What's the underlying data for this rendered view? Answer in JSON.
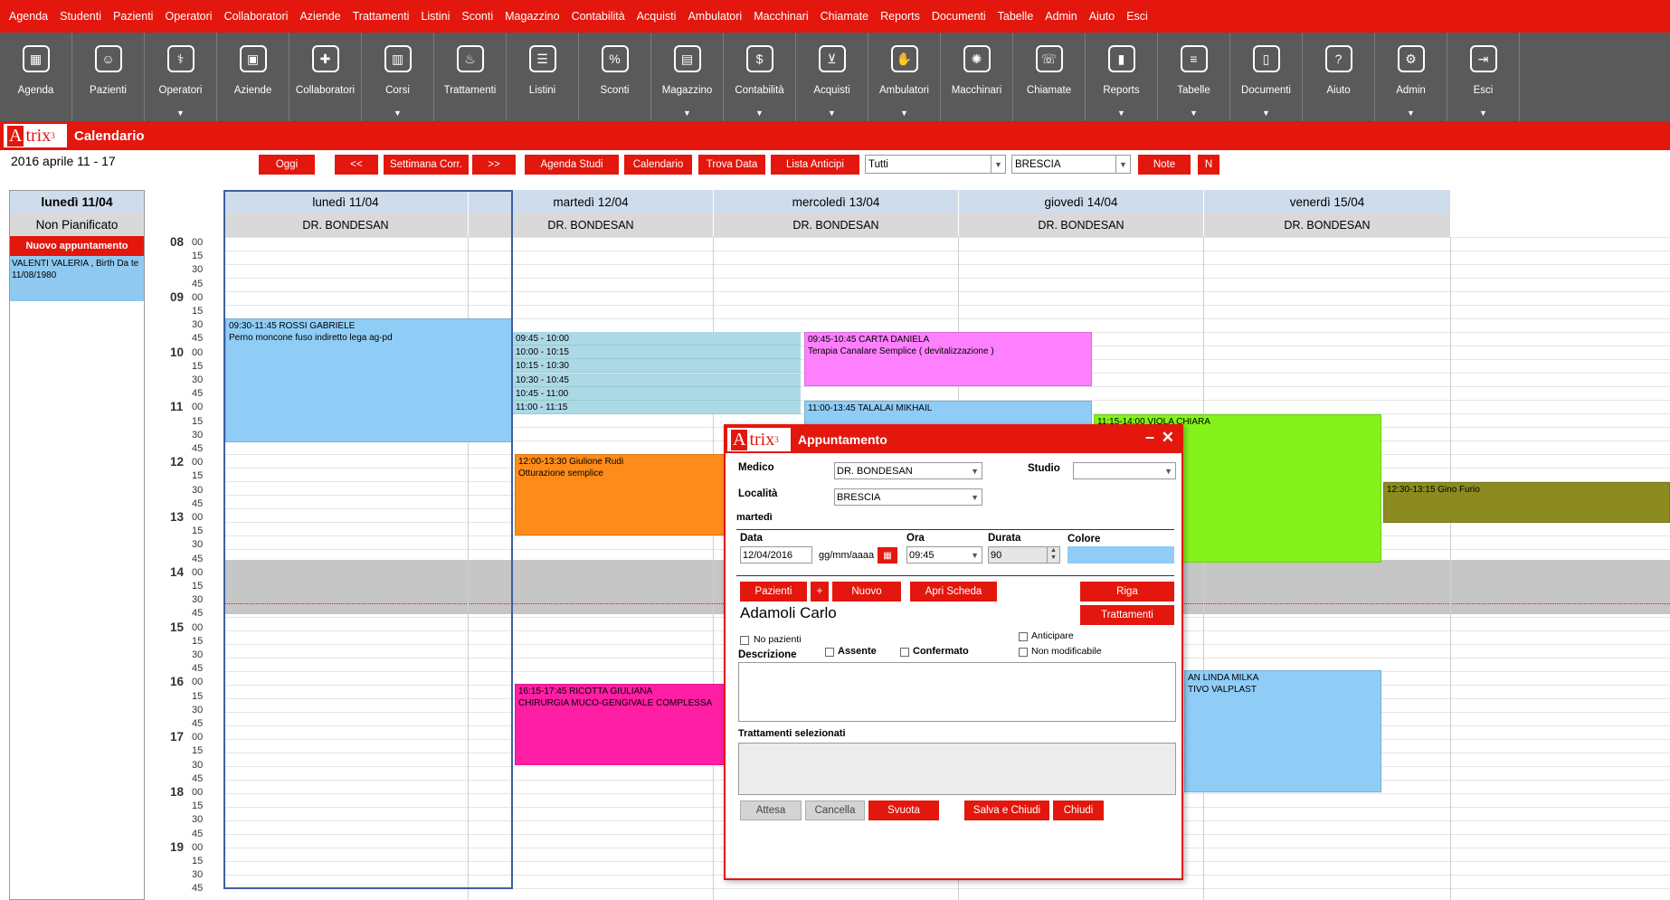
{
  "menu": [
    "Agenda",
    "Studenti",
    "Pazienti",
    "Operatori",
    "Collaboratori",
    "Aziende",
    "Trattamenti",
    "Listini",
    "Sconti",
    "Magazzino",
    "Contabilità",
    "Acquisti",
    "Ambulatori",
    "Macchinari",
    "Chiamate",
    "Reports",
    "Documenti",
    "Tabelle",
    "Admin",
    "Aiuto",
    "Esci"
  ],
  "toolbar": [
    {
      "label": "Agenda",
      "icon": "agenda-icon",
      "glyph": "▦"
    },
    {
      "label": "Pazienti",
      "icon": "patients-icon",
      "glyph": "☺"
    },
    {
      "label": "Operatori",
      "icon": "operators-icon",
      "glyph": "⚕",
      "dd": true
    },
    {
      "label": "Aziende",
      "icon": "companies-icon",
      "glyph": "▣"
    },
    {
      "label": "Collaboratori",
      "icon": "collaborators-icon",
      "glyph": "✚"
    },
    {
      "label": "Corsi",
      "icon": "courses-icon",
      "glyph": "▥",
      "dd": true
    },
    {
      "label": "Trattamenti",
      "icon": "treatments-icon",
      "glyph": "♨"
    },
    {
      "label": "Listini",
      "icon": "pricelists-icon",
      "glyph": "☰"
    },
    {
      "label": "Sconti",
      "icon": "discounts-icon",
      "glyph": "%"
    },
    {
      "label": "Magazzino",
      "icon": "warehouse-icon",
      "glyph": "▤",
      "dd": true
    },
    {
      "label": "Contabilità",
      "icon": "accounting-icon",
      "glyph": "$",
      "dd": true
    },
    {
      "label": "Acquisti",
      "icon": "cart-icon",
      "glyph": "⊻",
      "dd": true
    },
    {
      "label": "Ambulatori",
      "icon": "clinics-icon",
      "glyph": "✋",
      "dd": true
    },
    {
      "label": "Macchinari",
      "icon": "machines-icon",
      "glyph": "✺"
    },
    {
      "label": "Chiamate",
      "icon": "phone-icon",
      "glyph": "☏"
    },
    {
      "label": "Reports",
      "icon": "reports-icon",
      "glyph": "▮",
      "dd": true
    },
    {
      "label": "Tabelle",
      "icon": "tables-icon",
      "glyph": "≡",
      "dd": true
    },
    {
      "label": "Documenti",
      "icon": "documents-icon",
      "glyph": "▯",
      "dd": true
    },
    {
      "label": "Aiuto",
      "icon": "help-icon",
      "glyph": "?"
    },
    {
      "label": "Admin",
      "icon": "admin-icon",
      "glyph": "⚙",
      "dd": true
    },
    {
      "label": "Esci",
      "icon": "exit-icon",
      "glyph": "⇥",
      "dd": true
    }
  ],
  "header": {
    "logo": "A",
    "logo_rest": "trix",
    "logo_sup": "3",
    "title": "Calendario",
    "date_range": "2016 aprile 11 - 17"
  },
  "buttons": {
    "oggi": "Oggi",
    "prev": "<<",
    "settimana": "Settimana Corr.",
    "next": ">>",
    "agenda_studi": "Agenda Studi",
    "calendario": "Calendario",
    "trova_data": "Trova Data",
    "lista_anticipi": "Lista Anticipi",
    "note": "Note",
    "n": "N"
  },
  "filters": {
    "who": "Tutti",
    "where": "BRESCIA"
  },
  "left_panel": {
    "day": "lunedì 11/04",
    "non_pianificato": "Non Pianificato",
    "nuovo": "Nuovo appuntamento",
    "appt": "VALENTI VALERIA , Birth Da te 11/08/1980"
  },
  "days": [
    {
      "label": "lunedì 11/04",
      "doctor": "DR. BONDESAN"
    },
    {
      "label": "martedì 12/04",
      "doctor": "DR. BONDESAN"
    },
    {
      "label": "mercoledì 13/04",
      "doctor": "DR. BONDESAN"
    },
    {
      "label": "giovedì 14/04",
      "doctor": "DR. BONDESAN"
    },
    {
      "label": "venerdì 15/04",
      "doctor": "DR. BONDESAN"
    }
  ],
  "hours": [
    "08",
    "09",
    "10",
    "11",
    "12",
    "13",
    "14",
    "15",
    "16",
    "17",
    "18",
    "19"
  ],
  "minutes": [
    "00",
    "15",
    "30",
    "45"
  ],
  "appointments": [
    {
      "line1": "09:30-11:45 ROSSI GABRIELE",
      "line2": "Perno moncone fuso indiretto lega ag-pd",
      "color": "#8fcdf7"
    },
    {
      "line1": "09:45-10:45 CARTA DANIELA",
      "line2": "Terapia Canalare Semplice  ( devitalizzazione )",
      "color": "#ff80ff"
    },
    {
      "line1": "11:00-13:45 TALALAI MIKHAIL",
      "line2": "",
      "color": "#8fcdf7"
    },
    {
      "line1": "11:15-14:00 VIOLA CHIARA",
      "line2": "ca",
      "color": "#84f21b"
    },
    {
      "line1": "12:00-13:30 Giulione Rudi",
      "line2": "Otturazione semplice",
      "color": "#ff8c1a"
    },
    {
      "line1": "12:30-13:15 Gino Furio",
      "line2": "",
      "color": "#8b8b1f"
    },
    {
      "line1": "16:15-17:45 RICOTTA GIULIANA",
      "line2": "CHIRURGIA MUCO-GENGIVALE COMPLESSA",
      "color": "#ff1fa5"
    },
    {
      "line1": "AN LINDA MILKA",
      "line2": "TIVO VALPLAST",
      "color": "#8fcdf7"
    }
  ],
  "slots": [
    "09:45 - 10:00",
    "10:00 - 10:15",
    "10:15 - 10:30",
    "10:30 - 10:45",
    "10:45 - 11:00",
    "11:00 - 11:15"
  ],
  "dialog": {
    "logo": "A",
    "logo_rest": "trix",
    "logo_sup": "3",
    "title": "Appuntamento",
    "medico_label": "Medico",
    "medico": "DR. BONDESAN",
    "studio_label": "Studio",
    "studio": "",
    "localita_label": "Località",
    "localita": "BRESCIA",
    "weekday": "martedì",
    "data_label": "Data",
    "data": "12/04/2016",
    "data_fmt": "gg/mm/aaaa",
    "ora_label": "Ora",
    "ora": "09:45",
    "durata_label": "Durata",
    "durata": "90",
    "colore_label": "Colore",
    "colore": "#8fcdf7",
    "pazienti": "Pazienti",
    "plus": "+",
    "nuovo": "Nuovo",
    "apri_scheda": "Apri Scheda",
    "riga": "Riga",
    "trattamenti": "Trattamenti",
    "patient": "Adamoli Carlo",
    "no_pazienti": "No pazienti",
    "anticipare": "Anticipare",
    "non_modificabile": "Non modificabile",
    "descrizione": "Descrizione",
    "assente": "Assente",
    "confermato": "Confermato",
    "trattamenti_sel": "Trattamenti selezionati",
    "attesa": "Attesa",
    "cancella": "Cancella",
    "svuota": "Svuota",
    "salva_chiudi": "Salva e Chiudi",
    "chiudi": "Chiudi"
  }
}
